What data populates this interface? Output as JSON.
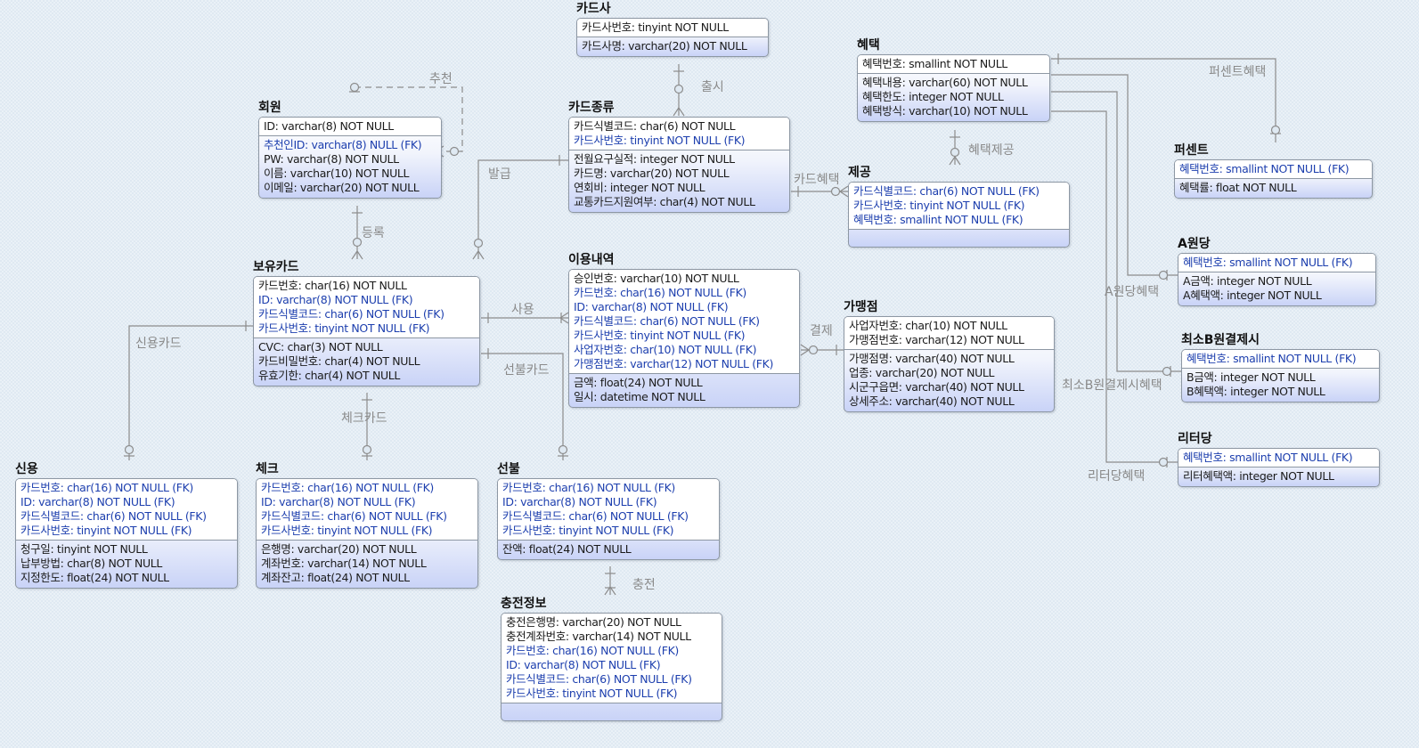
{
  "entities": {
    "carsa": {
      "name": "카드사",
      "keys": [
        {
          "t": "카드사번호: tinyint NOT NULL",
          "fk": false
        }
      ],
      "attrs": [
        {
          "t": "카드사명: varchar(20) NOT NULL",
          "fk": false
        }
      ]
    },
    "member": {
      "name": "회원",
      "keys": [
        {
          "t": "ID: varchar(8) NOT NULL",
          "fk": false
        }
      ],
      "attrs": [
        {
          "t": "추천인ID: varchar(8) NULL (FK)",
          "fk": true
        },
        {
          "t": "PW: varchar(8) NOT NULL",
          "fk": false
        },
        {
          "t": "이름: varchar(10) NOT NULL",
          "fk": false
        },
        {
          "t": "이메일: varchar(20) NOT NULL",
          "fk": false
        }
      ]
    },
    "cardtype": {
      "name": "카드종류",
      "keys": [
        {
          "t": "카드식별코드: char(6) NOT NULL",
          "fk": false
        },
        {
          "t": "카드사번호: tinyint NOT NULL (FK)",
          "fk": true
        }
      ],
      "attrs": [
        {
          "t": "전월요구실적: integer NOT NULL",
          "fk": false
        },
        {
          "t": "카드명: varchar(20) NOT NULL",
          "fk": false
        },
        {
          "t": "연회비: integer NOT NULL",
          "fk": false
        },
        {
          "t": "교통카드지원여부: char(4) NOT NULL",
          "fk": false
        }
      ]
    },
    "benefit": {
      "name": "혜택",
      "keys": [
        {
          "t": "혜택번호: smallint NOT NULL",
          "fk": false
        }
      ],
      "attrs": [
        {
          "t": "혜택내용: varchar(60) NOT NULL",
          "fk": false
        },
        {
          "t": "혜택한도: integer NOT NULL",
          "fk": false
        },
        {
          "t": "혜택방식: varchar(10) NOT NULL",
          "fk": false
        }
      ]
    },
    "provide": {
      "name": "제공",
      "keys": [
        {
          "t": "카드식별코드: char(6) NOT NULL (FK)",
          "fk": true
        },
        {
          "t": "카드사번호: tinyint NOT NULL (FK)",
          "fk": true
        },
        {
          "t": "혜택번호: smallint NOT NULL (FK)",
          "fk": true
        }
      ],
      "attrs": []
    },
    "percent": {
      "name": "퍼센트",
      "keys": [
        {
          "t": "혜택번호: smallint NOT NULL (FK)",
          "fk": true
        }
      ],
      "attrs": [
        {
          "t": "혜택률: float NOT NULL",
          "fk": false
        }
      ]
    },
    "aunit": {
      "name": "A원당",
      "keys": [
        {
          "t": "혜택번호: smallint NOT NULL (FK)",
          "fk": true
        }
      ],
      "attrs": [
        {
          "t": "A금액: integer NOT NULL",
          "fk": false
        },
        {
          "t": "A혜택액: integer NOT NULL",
          "fk": false
        }
      ]
    },
    "minpay": {
      "name": "최소B원결제시",
      "keys": [
        {
          "t": "혜택번호: smallint NOT NULL (FK)",
          "fk": true
        }
      ],
      "attrs": [
        {
          "t": "B금액: integer NOT NULL",
          "fk": false
        },
        {
          "t": "B혜택액: integer NOT NULL",
          "fk": false
        }
      ]
    },
    "liter": {
      "name": "리터당",
      "keys": [
        {
          "t": "혜택번호: smallint NOT NULL (FK)",
          "fk": true
        }
      ],
      "attrs": [
        {
          "t": "리터혜택액: integer NOT NULL",
          "fk": false
        }
      ]
    },
    "owncard": {
      "name": "보유카드",
      "keys": [
        {
          "t": "카드번호: char(16) NOT NULL",
          "fk": false
        },
        {
          "t": "ID: varchar(8) NOT NULL (FK)",
          "fk": true
        },
        {
          "t": "카드식별코드: char(6) NOT NULL (FK)",
          "fk": true
        },
        {
          "t": "카드사번호: tinyint NOT NULL (FK)",
          "fk": true
        }
      ],
      "attrs": [
        {
          "t": "CVC: char(3) NOT NULL",
          "fk": false
        },
        {
          "t": "카드비밀번호: char(4) NOT NULL",
          "fk": false
        },
        {
          "t": "유효기한: char(4) NOT NULL",
          "fk": false
        }
      ]
    },
    "usage": {
      "name": "이용내역",
      "keys": [
        {
          "t": "승인번호: varchar(10) NOT NULL",
          "fk": false
        },
        {
          "t": "카드번호: char(16) NOT NULL (FK)",
          "fk": true
        },
        {
          "t": "ID: varchar(8) NOT NULL (FK)",
          "fk": true
        },
        {
          "t": "카드식별코드: char(6) NOT NULL (FK)",
          "fk": true
        },
        {
          "t": "카드사번호: tinyint NOT NULL (FK)",
          "fk": true
        },
        {
          "t": "사업자번호: char(10) NOT NULL (FK)",
          "fk": true
        },
        {
          "t": "가맹점번호: varchar(12) NOT NULL (FK)",
          "fk": true
        }
      ],
      "attrs": [
        {
          "t": "금액: float(24) NOT NULL",
          "fk": false
        },
        {
          "t": "일시: datetime NOT NULL",
          "fk": false
        }
      ]
    },
    "store": {
      "name": "가맹점",
      "keys": [
        {
          "t": "사업자번호: char(10) NOT NULL",
          "fk": false
        },
        {
          "t": "가맹점번호: varchar(12) NOT NULL",
          "fk": false
        }
      ],
      "attrs": [
        {
          "t": "가맹점명: varchar(40) NOT NULL",
          "fk": false
        },
        {
          "t": "업종: varchar(20) NOT NULL",
          "fk": false
        },
        {
          "t": "시군구읍면: varchar(40) NOT NULL",
          "fk": false
        },
        {
          "t": "상세주소: varchar(40) NOT NULL",
          "fk": false
        }
      ]
    },
    "credit": {
      "name": "신용",
      "keys": [
        {
          "t": "카드번호: char(16) NOT NULL (FK)",
          "fk": true
        },
        {
          "t": "ID: varchar(8) NOT NULL (FK)",
          "fk": true
        },
        {
          "t": "카드식별코드: char(6) NOT NULL (FK)",
          "fk": true
        },
        {
          "t": "카드사번호: tinyint NOT NULL (FK)",
          "fk": true
        }
      ],
      "attrs": [
        {
          "t": "청구일: tinyint NOT NULL",
          "fk": false
        },
        {
          "t": "납부방법: char(8) NOT NULL",
          "fk": false
        },
        {
          "t": "지정한도: float(24) NOT NULL",
          "fk": false
        }
      ]
    },
    "check": {
      "name": "체크",
      "keys": [
        {
          "t": "카드번호: char(16) NOT NULL (FK)",
          "fk": true
        },
        {
          "t": "ID: varchar(8) NOT NULL (FK)",
          "fk": true
        },
        {
          "t": "카드식별코드: char(6) NOT NULL (FK)",
          "fk": true
        },
        {
          "t": "카드사번호: tinyint NOT NULL (FK)",
          "fk": true
        }
      ],
      "attrs": [
        {
          "t": "은행명: varchar(20) NOT NULL",
          "fk": false
        },
        {
          "t": "계좌번호: varchar(14) NOT NULL",
          "fk": false
        },
        {
          "t": "계좌잔고: float(24) NOT NULL",
          "fk": false
        }
      ]
    },
    "prepaid": {
      "name": "선불",
      "keys": [
        {
          "t": "카드번호: char(16) NOT NULL (FK)",
          "fk": true
        },
        {
          "t": "ID: varchar(8) NOT NULL (FK)",
          "fk": true
        },
        {
          "t": "카드식별코드: char(6) NOT NULL (FK)",
          "fk": true
        },
        {
          "t": "카드사번호: tinyint NOT NULL (FK)",
          "fk": true
        }
      ],
      "attrs": [
        {
          "t": "잔액: float(24) NOT NULL",
          "fk": false
        }
      ]
    },
    "charge": {
      "name": "충전정보",
      "keys": [
        {
          "t": "충전은행명: varchar(20) NOT NULL",
          "fk": false
        },
        {
          "t": "충전계좌번호: varchar(14) NOT NULL",
          "fk": false
        },
        {
          "t": "카드번호: char(16) NOT NULL (FK)",
          "fk": true
        },
        {
          "t": "ID: varchar(8) NOT NULL (FK)",
          "fk": true
        },
        {
          "t": "카드식별코드: char(6) NOT NULL (FK)",
          "fk": true
        },
        {
          "t": "카드사번호: tinyint NOT NULL (FK)",
          "fk": true
        }
      ],
      "attrs": []
    }
  },
  "relationships": {
    "recommend": "추천",
    "release": "출시",
    "issue": "발급",
    "register": "등록",
    "card_benefit": "카드혜택",
    "benefit_provide": "혜택제공",
    "percent_benefit": "퍼센트혜택",
    "aunit_benefit": "A원당혜택",
    "minpay_benefit": "최소B원결제시혜택",
    "liter_benefit": "리터당혜택",
    "use": "사용",
    "payment": "결제",
    "credit_card": "신용카드",
    "check_card": "체크카드",
    "prepaid_card": "선불카드",
    "charging": "충전"
  },
  "colors": {
    "fk_text": "#1d3fae",
    "plain_text": "#1b1b1b",
    "connector": "#8c8c8c",
    "entity_gradient_bottom": "#c9d3f7"
  }
}
